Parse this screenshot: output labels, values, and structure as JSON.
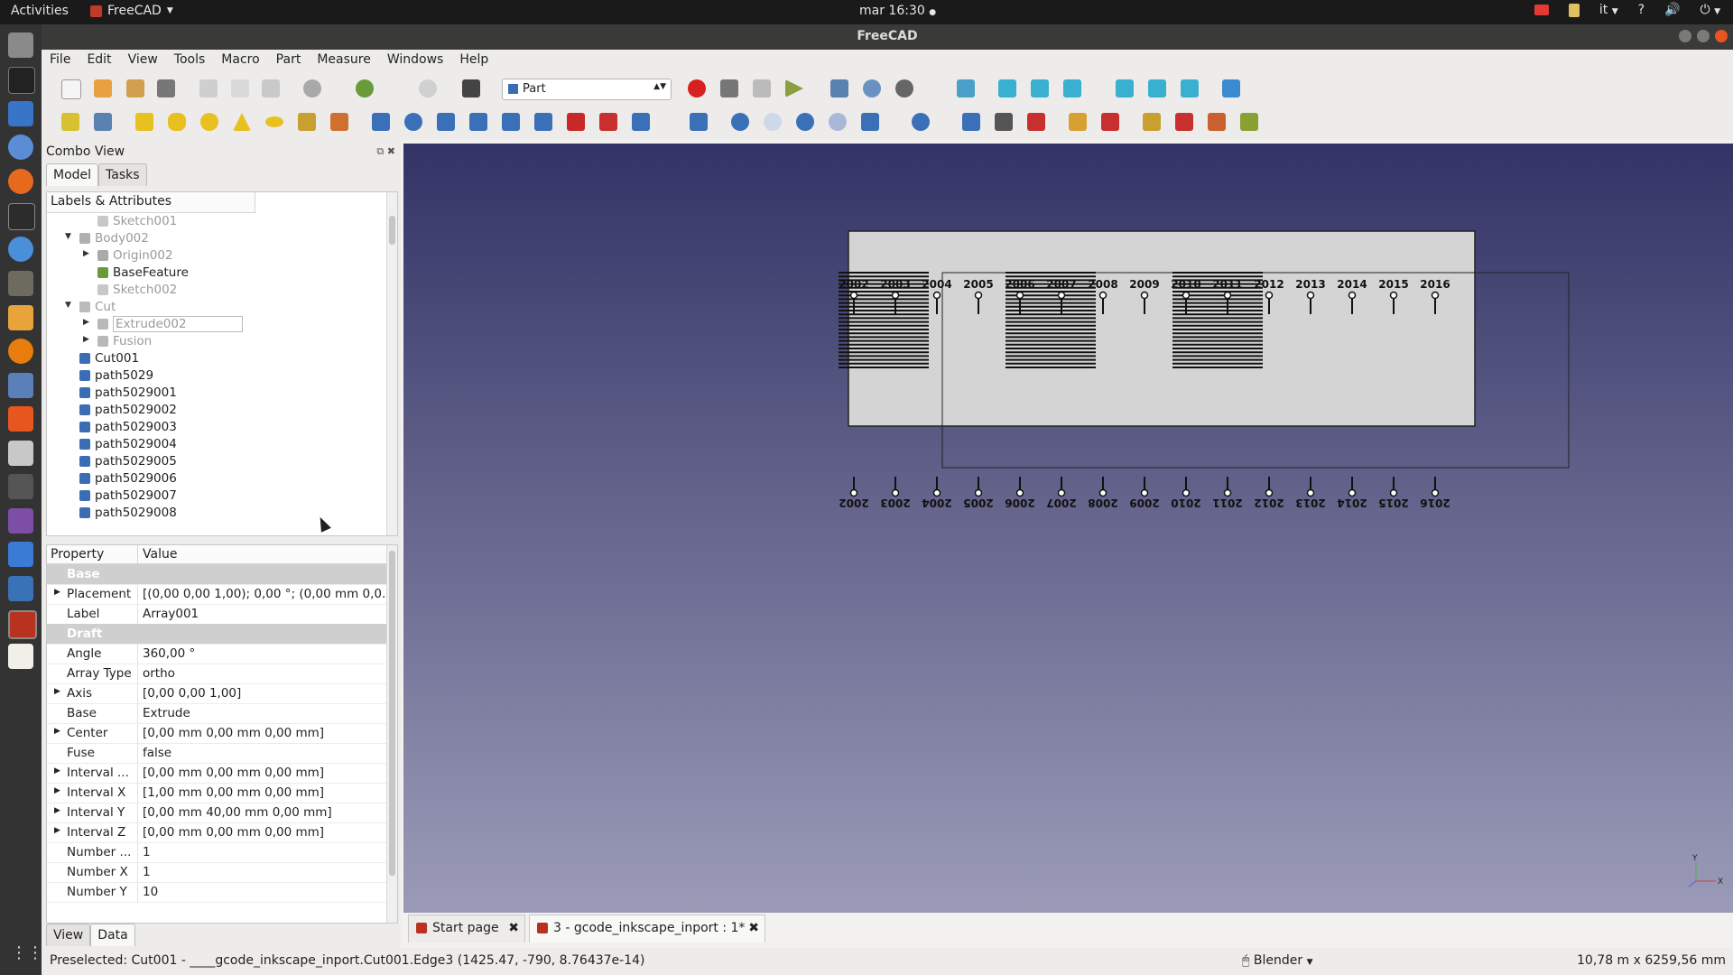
{
  "topbar": {
    "activities": "Activities",
    "app_name": "FreeCAD",
    "clock": "mar 16:30",
    "lang": "it"
  },
  "window": {
    "title": "FreeCAD"
  },
  "menu": [
    "File",
    "Edit",
    "View",
    "Tools",
    "Macro",
    "Part",
    "Measure",
    "Windows",
    "Help"
  ],
  "toolbar": {
    "workbench": "Part"
  },
  "combo": {
    "title": "Combo View",
    "tabs": [
      "Model",
      "Tasks"
    ],
    "tree_header": "Labels & Attributes",
    "tree_items": [
      {
        "label": "Sketch001",
        "indent": 2,
        "toggle": "",
        "dim": true,
        "icon": "sketch"
      },
      {
        "label": "Body002",
        "indent": 1,
        "toggle": "▼",
        "dim": true,
        "icon": "body"
      },
      {
        "label": "Origin002",
        "indent": 2,
        "toggle": "▶",
        "dim": true,
        "icon": "origin"
      },
      {
        "label": "BaseFeature",
        "indent": 2,
        "toggle": "",
        "dim": false,
        "icon": "feature"
      },
      {
        "label": "Sketch002",
        "indent": 2,
        "toggle": "",
        "dim": true,
        "icon": "sketch"
      },
      {
        "label": "Cut",
        "indent": 1,
        "toggle": "▼",
        "dim": true,
        "icon": "cut"
      },
      {
        "label": "Extrude002",
        "indent": 2,
        "toggle": "▶",
        "dim": true,
        "icon": "extrude"
      },
      {
        "label": "Fusion",
        "indent": 2,
        "toggle": "▶",
        "dim": true,
        "icon": "fusion"
      },
      {
        "label": "Cut001",
        "indent": 1,
        "toggle": "",
        "dim": false,
        "icon": "solid"
      },
      {
        "label": "path5029",
        "indent": 1,
        "toggle": "",
        "dim": false,
        "icon": "solid"
      },
      {
        "label": "path5029001",
        "indent": 1,
        "toggle": "",
        "dim": false,
        "icon": "solid"
      },
      {
        "label": "path5029002",
        "indent": 1,
        "toggle": "",
        "dim": false,
        "icon": "solid"
      },
      {
        "label": "path5029003",
        "indent": 1,
        "toggle": "",
        "dim": false,
        "icon": "solid"
      },
      {
        "label": "path5029004",
        "indent": 1,
        "toggle": "",
        "dim": false,
        "icon": "solid"
      },
      {
        "label": "path5029005",
        "indent": 1,
        "toggle": "",
        "dim": false,
        "icon": "solid"
      },
      {
        "label": "path5029006",
        "indent": 1,
        "toggle": "",
        "dim": false,
        "icon": "solid"
      },
      {
        "label": "path5029007",
        "indent": 1,
        "toggle": "",
        "dim": false,
        "icon": "solid"
      },
      {
        "label": "path5029008",
        "indent": 1,
        "toggle": "",
        "dim": false,
        "icon": "solid"
      }
    ],
    "prop_header": {
      "property": "Property",
      "value": "Value"
    },
    "properties": [
      {
        "group": "Base"
      },
      {
        "name": "Placement",
        "value": "[(0,00 0,00 1,00); 0,00 °; (0,00 mm  0,0...",
        "exp": true
      },
      {
        "name": "Label",
        "value": "Array001",
        "exp": false
      },
      {
        "group": "Draft"
      },
      {
        "name": "Angle",
        "value": "360,00 °",
        "exp": false
      },
      {
        "name": "Array Type",
        "value": "ortho",
        "exp": false
      },
      {
        "name": "Axis",
        "value": "[0,00 0,00 1,00]",
        "exp": true
      },
      {
        "name": "Base",
        "value": "Extrude",
        "exp": false
      },
      {
        "name": "Center",
        "value": "[0,00 mm  0,00 mm  0,00 mm]",
        "exp": true
      },
      {
        "name": "Fuse",
        "value": "false",
        "exp": false
      },
      {
        "name": "Interval ...",
        "value": "[0,00 mm  0,00 mm  0,00 mm]",
        "exp": true
      },
      {
        "name": "Interval X",
        "value": "[1,00 mm  0,00 mm  0,00 mm]",
        "exp": true
      },
      {
        "name": "Interval Y",
        "value": "[0,00 mm  40,00 mm  0,00 mm]",
        "exp": true
      },
      {
        "name": "Interval Z",
        "value": "[0,00 mm  0,00 mm  0,00 mm]",
        "exp": true
      },
      {
        "name": "Number ...",
        "value": "1",
        "exp": false
      },
      {
        "name": "Number X",
        "value": "1",
        "exp": false
      },
      {
        "name": "Number Y",
        "value": "10",
        "exp": false
      }
    ],
    "bottom_tabs": [
      "View",
      "Data"
    ]
  },
  "scene": {
    "top_years": [
      "2002",
      "2003",
      "2004",
      "2005",
      "2006",
      "2007",
      "2008",
      "2009",
      "2010",
      "2011",
      "2012",
      "2013",
      "2014",
      "2015",
      "2016"
    ],
    "bottom_years": [
      "2002",
      "2003",
      "2004",
      "2005",
      "2006",
      "2007",
      "2008",
      "2009",
      "2010",
      "2011",
      "2012",
      "2013",
      "2014",
      "2015",
      "2016"
    ]
  },
  "doc_tabs": [
    "Start page",
    "3 - gcode_inkscape_inport : 1*"
  ],
  "status": {
    "message": "Preselected: Cut001 - ____gcode_inkscape_inport.Cut001.Edge3 (1425.47, -790, 8.76437e-14)",
    "nav_style": "Blender",
    "dimensions": "10,78 m x 6259,56 mm"
  }
}
